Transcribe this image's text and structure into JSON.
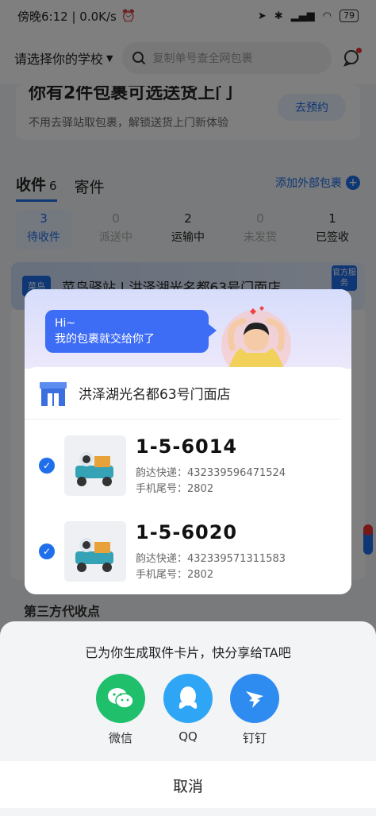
{
  "status_bar": {
    "time": "傍晚6:12 | 0.0K/s",
    "battery": "79"
  },
  "topbar": {
    "school": "请选择你的学校",
    "search_placeholder": "复制单号查全网包裹"
  },
  "promo": {
    "title": "你有2件包裹可选送货上门",
    "subtitle": "不用去驿站取包裹，解锁送货上门新体验",
    "button": "去预约"
  },
  "tabs": [
    {
      "label": "收件",
      "count": "6"
    },
    {
      "label": "寄件"
    }
  ],
  "add_external": "添加外部包裹",
  "stats": [
    {
      "num": "3",
      "label": "待收件"
    },
    {
      "num": "0",
      "label": "派送中"
    },
    {
      "num": "2",
      "label": "运输中"
    },
    {
      "num": "0",
      "label": "未发货"
    },
    {
      "num": "1",
      "label": "已签收"
    }
  ],
  "station": {
    "logo": "菜鸟",
    "name": "菜鸟驿站 | 洪泽湖光名都63号门面店",
    "badge": "官方服务"
  },
  "third_party": "第三方代收点",
  "modal": {
    "bubble_line1": "Hi~",
    "bubble_line2": "我的包裹就交给你了",
    "store_name": "洪泽湖光名都63号门面店",
    "packages": [
      {
        "code": "1-5-6014",
        "courier": "韵达快递：432339596471524",
        "phone": "手机尾号：2802"
      },
      {
        "code": "1-5-6020",
        "courier": "韵达快递：432339571311583",
        "phone": "手机尾号：2802"
      }
    ]
  },
  "share": {
    "title": "已为你生成取件卡片，快分享给TA吧",
    "items": [
      {
        "label": "微信",
        "color": "#1fbf6b",
        "icon": "wechat-icon"
      },
      {
        "label": "QQ",
        "color": "#2fa6f5",
        "icon": "qq-icon"
      },
      {
        "label": "钉钉",
        "color": "#2e8cf0",
        "icon": "dingtalk-icon"
      }
    ],
    "cancel": "取消"
  }
}
